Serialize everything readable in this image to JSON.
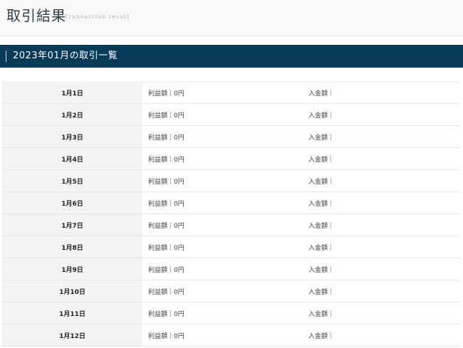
{
  "header": {
    "title": "取引結果",
    "subtitle": "Transaction result"
  },
  "section": {
    "title": "2023年01月の取引一覧"
  },
  "rows": [
    {
      "date": "1月1日",
      "profit": "利益額｜0円",
      "deposit": "入金額｜"
    },
    {
      "date": "1月2日",
      "profit": "利益額｜0円",
      "deposit": "入金額｜"
    },
    {
      "date": "1月3日",
      "profit": "利益額｜0円",
      "deposit": "入金額｜"
    },
    {
      "date": "1月4日",
      "profit": "利益額｜0円",
      "deposit": "入金額｜"
    },
    {
      "date": "1月5日",
      "profit": "利益額｜0円",
      "deposit": "入金額｜"
    },
    {
      "date": "1月6日",
      "profit": "利益額｜0円",
      "deposit": "入金額｜"
    },
    {
      "date": "1月7日",
      "profit": "利益額｜0円",
      "deposit": "入金額｜"
    },
    {
      "date": "1月8日",
      "profit": "利益額｜0円",
      "deposit": "入金額｜"
    },
    {
      "date": "1月9日",
      "profit": "利益額｜0円",
      "deposit": "入金額｜"
    },
    {
      "date": "1月10日",
      "profit": "利益額｜0円",
      "deposit": "入金額｜"
    },
    {
      "date": "1月11日",
      "profit": "利益額｜0円",
      "deposit": "入金額｜"
    },
    {
      "date": "1月12日",
      "profit": "利益額｜0円",
      "deposit": "入金額｜"
    }
  ],
  "colors": {
    "section_bar": "#083a59",
    "date_cell_bg": "#f3f3f3",
    "header_bg": "#f8f8f8"
  }
}
